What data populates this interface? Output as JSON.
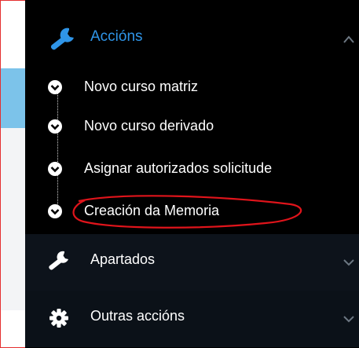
{
  "menu": {
    "active_section": {
      "title": "Accións",
      "icon": "wrench-icon",
      "expanded": true,
      "items": [
        {
          "label": "Novo curso matriz"
        },
        {
          "label": "Novo curso derivado"
        },
        {
          "label": "Asignar autorizados solicitude"
        },
        {
          "label": "Creación da Memoria"
        }
      ]
    },
    "sections": [
      {
        "label": "Apartados",
        "icon": "wrench-icon"
      },
      {
        "label": "Outras accións",
        "icon": "gear-icon"
      }
    ]
  },
  "colors": {
    "menu_bg": "#000000",
    "accent": "#2f95e8",
    "text": "#ffffff",
    "annotation": "#e0141b",
    "frame_border": "#e53030",
    "left_band": "#7cc3ea"
  }
}
